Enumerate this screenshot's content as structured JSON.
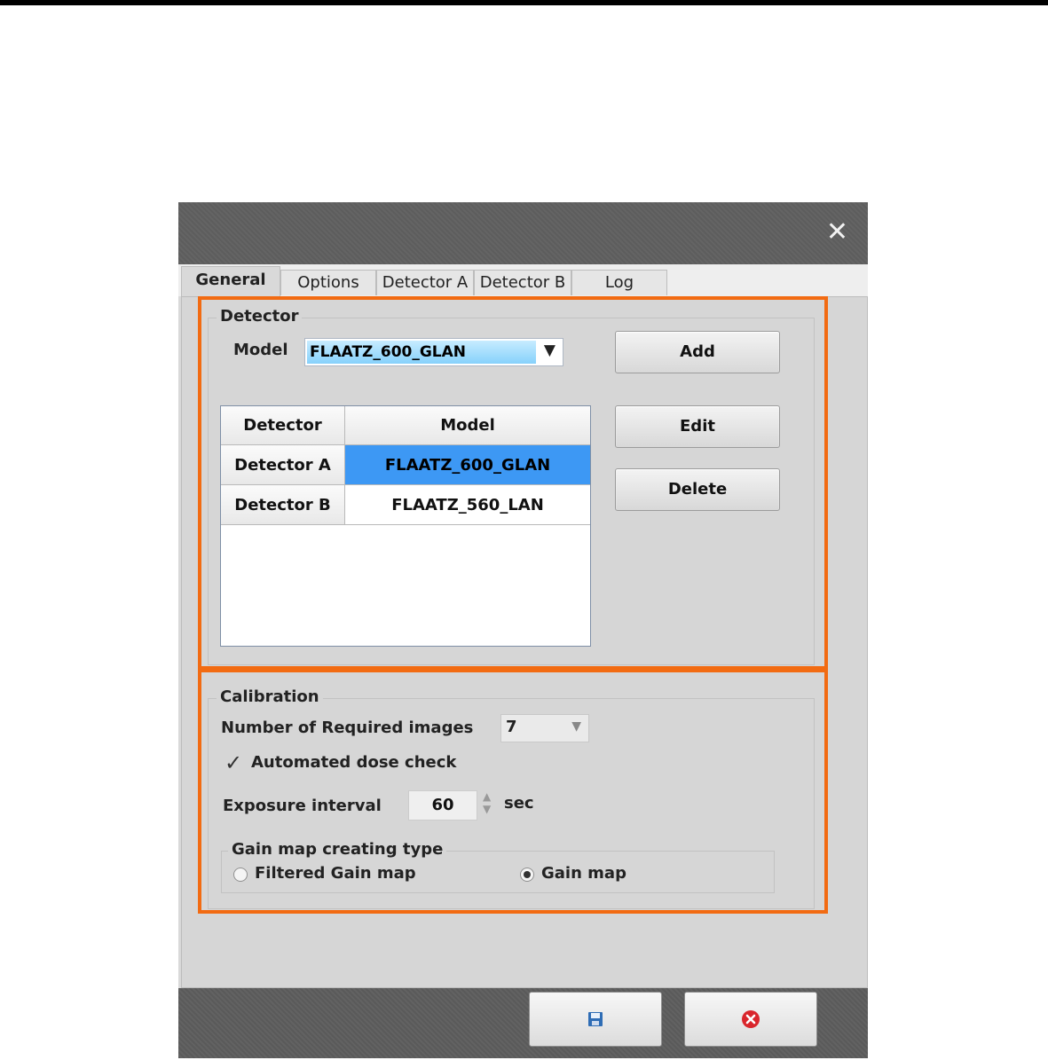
{
  "tabs": [
    {
      "label": "General",
      "active": true
    },
    {
      "label": "Options"
    },
    {
      "label": "Detector A"
    },
    {
      "label": "Detector B"
    },
    {
      "label": "Log"
    }
  ],
  "detector": {
    "group_title": "Detector",
    "model_label": "Model",
    "model_value": "FLAATZ_600_GLAN",
    "buttons": {
      "add": "Add",
      "edit": "Edit",
      "delete": "Delete"
    },
    "table": {
      "headers": [
        "Detector",
        "Model"
      ],
      "rows": [
        {
          "detector": "Detector A",
          "model": "FLAATZ_600_GLAN",
          "selected": true
        },
        {
          "detector": "Detector B",
          "model": "FLAATZ_560_LAN"
        }
      ]
    }
  },
  "calibration": {
    "group_title": "Calibration",
    "num_images_label": "Number of Required images",
    "num_images_value": "7",
    "auto_dose_label": "Automated dose check",
    "auto_dose_checked": true,
    "exposure_label": "Exposure interval",
    "exposure_value": "60",
    "exposure_unit": "sec",
    "gain_group_title": "Gain map creating type",
    "gain_options": [
      {
        "label": "Filtered Gain map",
        "selected": false
      },
      {
        "label": "Gain map",
        "selected": true
      }
    ]
  },
  "colors": {
    "highlight": "#f26b12",
    "selection": "#3d98f4",
    "combo_selection": "#86d1fb"
  },
  "icons": {
    "close": "close-icon",
    "save": "save-icon",
    "cancel": "cancel-icon"
  }
}
